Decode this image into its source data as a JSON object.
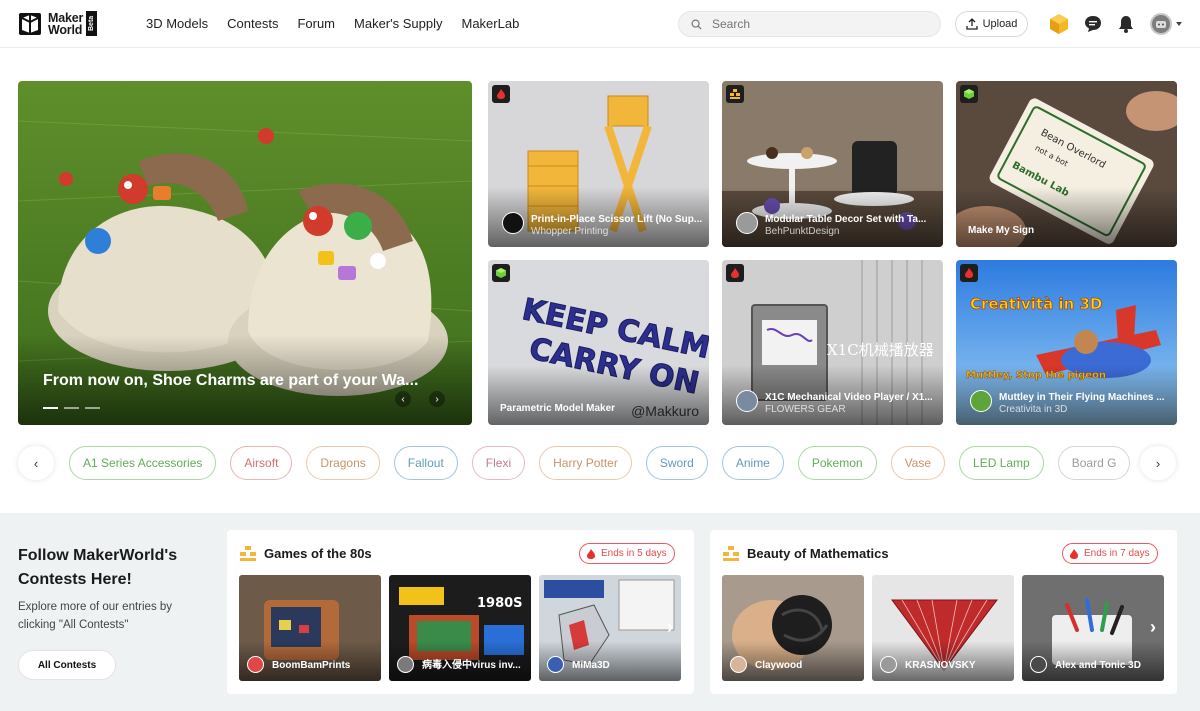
{
  "brand": {
    "name_line1": "Maker",
    "name_line2": "World",
    "beta": "Beta"
  },
  "nav": [
    "3D Models",
    "Contests",
    "Forum",
    "Maker's Supply",
    "MakerLab"
  ],
  "search": {
    "placeholder": "Search"
  },
  "upload_label": "Upload",
  "hero": {
    "title": "From now on, Shoe Charms are part of your Wa...",
    "slide_count": 3,
    "active_slide": 1
  },
  "featured": [
    {
      "title": "Print-in-Place Scissor Lift (No Sup...",
      "author": "Whopper Printing",
      "badge": "flame-icon"
    },
    {
      "title": "Modular Table Decor Set with Ta...",
      "author": "BehPunktDesign",
      "badge": "gold-stack-icon"
    },
    {
      "title": "Make My Sign",
      "author": "",
      "badge": "cube-icon"
    },
    {
      "title": "Parametric Model Maker",
      "author": "",
      "badge": "cube-icon",
      "image_caption": "@Makkuro",
      "image_text": "KEEP CALM CARRY ON"
    },
    {
      "title": "X1C Mechanical Video Player / X1...",
      "author": "FLOWERS GEAR",
      "badge": "flame-icon",
      "image_text": "X1C机械播放器"
    },
    {
      "title": "Muttley in Their Flying Machines ...",
      "author": "Creativita in 3D",
      "badge": "flame-icon",
      "image_text": "Creatività in 3D",
      "image_text2": "Muttley, Stop the pigeon"
    }
  ],
  "tags": [
    {
      "label": "A1 Series Accessories",
      "color": "green"
    },
    {
      "label": "Airsoft",
      "color": "red"
    },
    {
      "label": "Dragons",
      "color": "orange"
    },
    {
      "label": "Fallout",
      "color": "blue"
    },
    {
      "label": "Flexi",
      "color": "pink"
    },
    {
      "label": "Harry Potter",
      "color": "orange"
    },
    {
      "label": "Sword",
      "color": "blue"
    },
    {
      "label": "Anime",
      "color": "blue"
    },
    {
      "label": "Pokemon",
      "color": "green"
    },
    {
      "label": "Vase",
      "color": "orange"
    },
    {
      "label": "LED Lamp",
      "color": "green"
    },
    {
      "label": "Board G",
      "color": "grey"
    }
  ],
  "contests_intro": {
    "title": "Follow MakerWorld's Contests Here!",
    "description": "Explore more of our entries by clicking \"All Contests\"",
    "button": "All Contests"
  },
  "contests": [
    {
      "title": "Games of the 80s",
      "ends": "Ends in 5 days",
      "entries": [
        {
          "author": "BoomBamPrints"
        },
        {
          "author": "病毒入侵中virus inv...",
          "image_text": "1980S"
        },
        {
          "author": "MiMa3D"
        }
      ]
    },
    {
      "title": "Beauty of Mathematics",
      "ends": "Ends in 7 days",
      "entries": [
        {
          "author": "Claywood"
        },
        {
          "author": "KRASNOVSKY"
        },
        {
          "author": "Alex and Tonic 3D"
        }
      ]
    }
  ],
  "colors": {
    "accent_red": "#e14c4e",
    "tag_green": "#5fae57",
    "band_bg": "#eef2f3"
  }
}
